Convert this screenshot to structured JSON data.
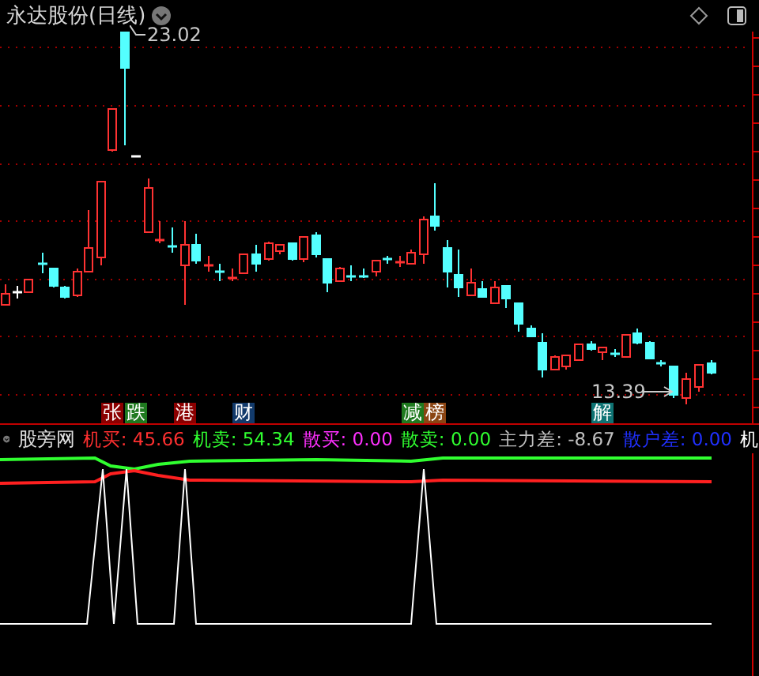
{
  "window": {
    "title": "永达股份(日线)"
  },
  "price_labels": {
    "high": "23.02",
    "low": "13.39"
  },
  "event_tags": [
    {
      "text": "张",
      "color": "#8b0000"
    },
    {
      "text": "跌",
      "color": "#1f7a1f"
    },
    {
      "text": "港",
      "color": "#8b0000"
    },
    {
      "text": "财",
      "color": "#123a6b"
    },
    {
      "text": "减",
      "color": "#1f7a1f"
    },
    {
      "text": "榜",
      "color": "#8b4513"
    },
    {
      "text": "解",
      "color": "#0e7373"
    }
  ],
  "indicator": {
    "name": "股旁网",
    "values": [
      {
        "text": "机买: 45.66",
        "color": "#ff3030"
      },
      {
        "text": "机卖: 54.34",
        "color": "#30ff30"
      },
      {
        "text": "散买: 0.00",
        "color": "#ff30ff"
      },
      {
        "text": "散卖: 0.00",
        "color": "#30ff30"
      },
      {
        "text": "主力差: -8.67",
        "color": "#c0c0c0"
      },
      {
        "text": "散户差: 0.00",
        "color": "#2030ff"
      },
      {
        "text": "机",
        "color": "#ffffff"
      }
    ]
  }
}
